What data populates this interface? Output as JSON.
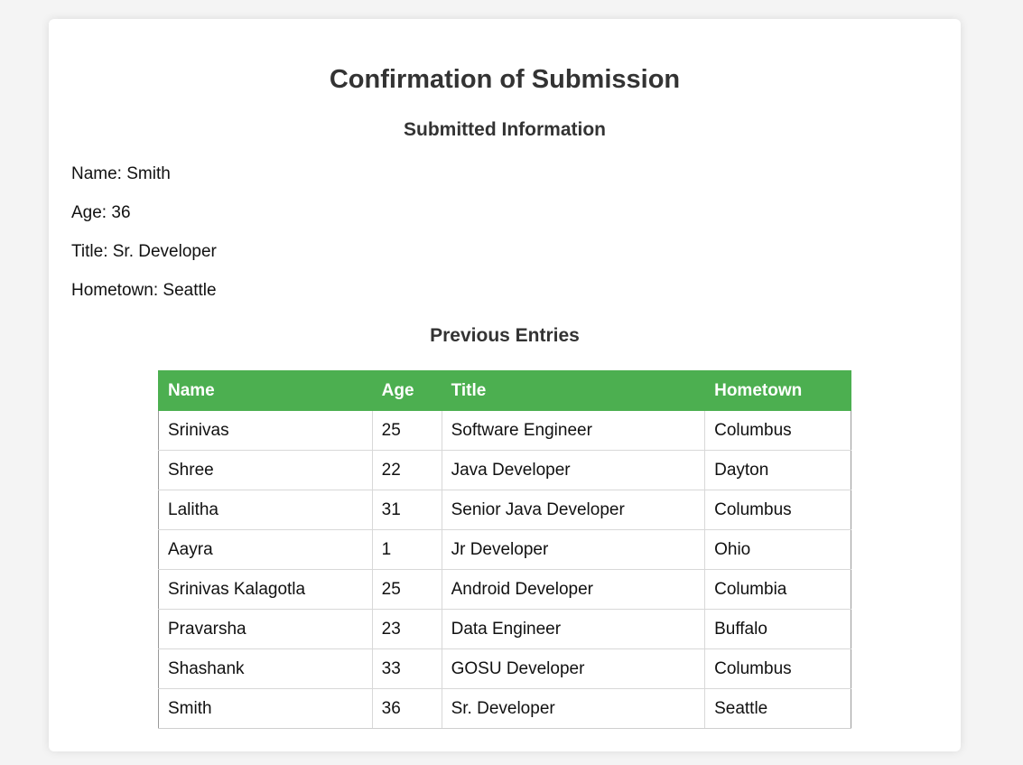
{
  "page": {
    "title": "Confirmation of Submission"
  },
  "submitted": {
    "heading": "Submitted Information",
    "fields": [
      {
        "label": "Name:",
        "value": "Smith"
      },
      {
        "label": "Age:",
        "value": "36"
      },
      {
        "label": "Title:",
        "value": "Sr. Developer"
      },
      {
        "label": "Hometown:",
        "value": "Seattle"
      }
    ]
  },
  "previous": {
    "heading": "Previous Entries",
    "columns": [
      "Name",
      "Age",
      "Title",
      "Hometown"
    ],
    "rows": [
      [
        "Srinivas",
        "25",
        "Software Engineer",
        "Columbus"
      ],
      [
        "Shree",
        "22",
        "Java Developer",
        "Dayton"
      ],
      [
        "Lalitha",
        "31",
        "Senior Java Developer",
        "Columbus"
      ],
      [
        "Aayra",
        "1",
        "Jr Developer",
        "Ohio"
      ],
      [
        "Srinivas Kalagotla",
        "25",
        "Android Developer",
        "Columbia"
      ],
      [
        "Pravarsha",
        "23",
        "Data Engineer",
        "Buffalo"
      ],
      [
        "Shashank",
        "33",
        "GOSU Developer",
        "Columbus"
      ],
      [
        "Smith",
        "36",
        "Sr. Developer",
        "Seattle"
      ]
    ]
  },
  "colors": {
    "header_bg": "#4caf50",
    "header_text": "#ffffff",
    "page_bg": "#f4f4f4",
    "card_bg": "#ffffff"
  }
}
